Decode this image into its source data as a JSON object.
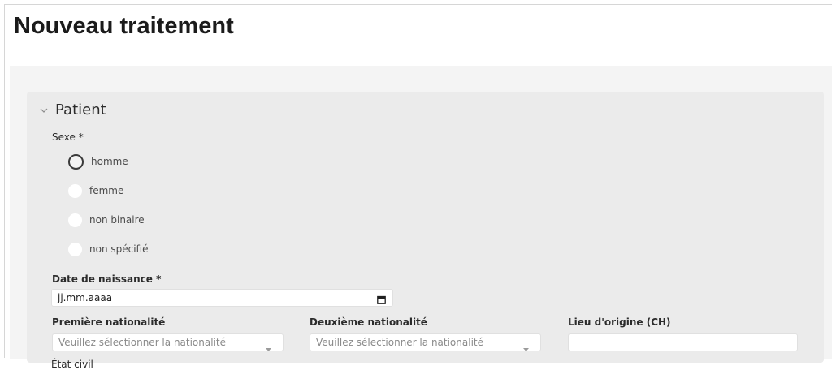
{
  "page": {
    "title": "Nouveau traitement"
  },
  "patient_section": {
    "title": "Patient",
    "sexe": {
      "label": "Sexe *",
      "options": [
        "homme",
        "femme",
        "non binaire",
        "non spécifié"
      ]
    },
    "date_naissance": {
      "label": "Date de naissance *",
      "placeholder": "jj.mm.aaaa"
    },
    "premiere_nationalite": {
      "label": "Première nationalité",
      "placeholder": "Veuillez sélectionner la nationalité"
    },
    "deuxieme_nationalite": {
      "label": "Deuxième nationalité",
      "placeholder": "Veuillez sélectionner la nationalité"
    },
    "lieu_origine": {
      "label": "Lieu d'origine (CH)",
      "value": ""
    },
    "next_field_label": "État civil"
  },
  "icons": {
    "section_toggle": "chevron-down-icon",
    "date_picker": "calendar-icon",
    "select_caret": "caret-down-icon"
  }
}
